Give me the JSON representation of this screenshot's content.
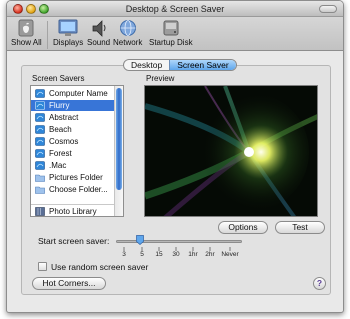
{
  "window": {
    "title": "Desktop & Screen Saver"
  },
  "toolbar": {
    "items": [
      {
        "label": "Show All",
        "icon": "show-all-icon"
      },
      {
        "label": "Displays",
        "icon": "displays-icon"
      },
      {
        "label": "Sound",
        "icon": "sound-icon"
      },
      {
        "label": "Network",
        "icon": "network-icon"
      },
      {
        "label": "Startup Disk",
        "icon": "startup-disk-icon"
      }
    ]
  },
  "tabs": [
    {
      "label": "Desktop",
      "selected": false
    },
    {
      "label": "Screen Saver",
      "selected": true
    }
  ],
  "screen_savers": {
    "label": "Screen Savers",
    "items": [
      {
        "label": "Computer Name",
        "icon": "screensaver-icon",
        "selected": false
      },
      {
        "label": "Flurry",
        "icon": "screensaver-icon",
        "selected": true
      },
      {
        "label": "Abstract",
        "icon": "screensaver-icon",
        "selected": false
      },
      {
        "label": "Beach",
        "icon": "screensaver-icon",
        "selected": false
      },
      {
        "label": "Cosmos",
        "icon": "screensaver-icon",
        "selected": false
      },
      {
        "label": "Forest",
        "icon": "screensaver-icon",
        "selected": false
      },
      {
        "label": ".Mac",
        "icon": "screensaver-icon",
        "selected": false
      },
      {
        "label": "Pictures Folder",
        "icon": "folder-icon",
        "selected": false
      },
      {
        "label": "Choose Folder...",
        "icon": "folder-icon",
        "selected": false
      },
      {
        "label": "Photo Library",
        "icon": "photo-library-icon",
        "selected": false
      }
    ]
  },
  "preview": {
    "label": "Preview"
  },
  "buttons": {
    "options": "Options",
    "test": "Test",
    "hot_corners": "Hot Corners..."
  },
  "start_screen_saver": {
    "label": "Start screen saver:",
    "ticks": [
      "3",
      "5",
      "15",
      "30",
      "1hr",
      "2hr",
      "Never"
    ],
    "selected": "15"
  },
  "random": {
    "label": "Use random screen saver",
    "checked": false
  },
  "help": {
    "label": "?"
  },
  "colors": {
    "selection": "#3875d7",
    "tab_selected": "#5ea6ec",
    "preview_bg": "#050a05"
  }
}
